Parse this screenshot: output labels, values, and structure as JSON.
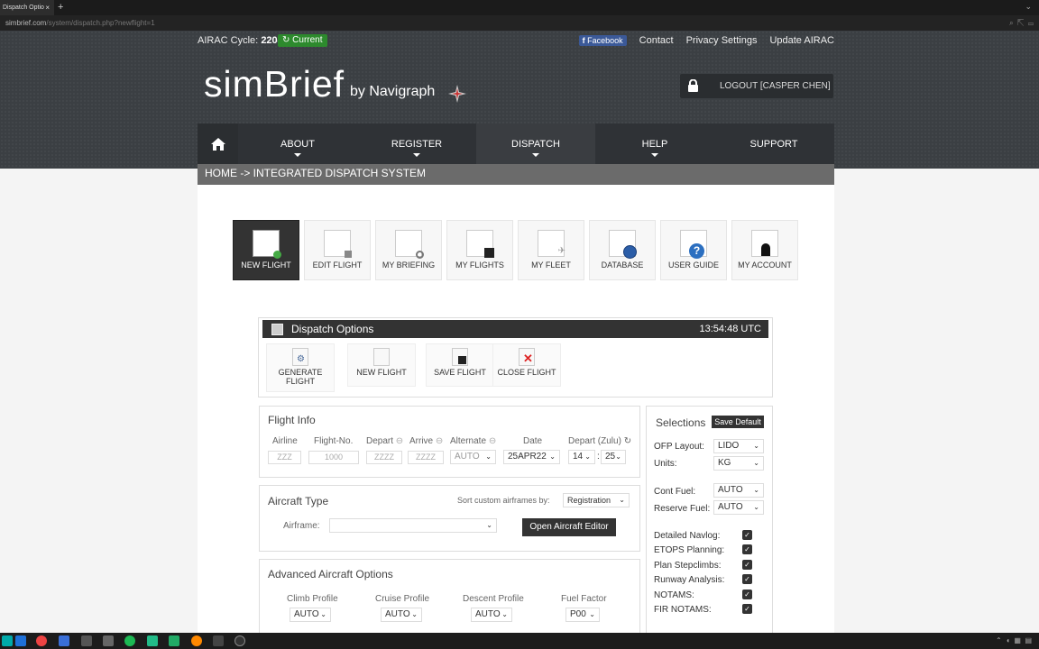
{
  "browser": {
    "tab_title": "Dispatch Optio",
    "tab_close": "×",
    "new_tab": "+",
    "url_host": "simbrief.com",
    "url_path": "/system/dispatch.php?newflight=1"
  },
  "topbar": {
    "airac_label": "AIRAC Cycle:",
    "airac_value": "2204",
    "current_label": "Current",
    "facebook_label": "Facebook",
    "links": [
      "Contact",
      "Privacy Settings",
      "Update AIRAC"
    ]
  },
  "brand": {
    "logo": "simBrief",
    "by": "by Navigraph"
  },
  "account": {
    "logout_label": "LOGOUT [CASPER CHEN]"
  },
  "nav": {
    "items": [
      "ABOUT",
      "REGISTER",
      "DISPATCH",
      "HELP",
      "SUPPORT"
    ],
    "active": "DISPATCH"
  },
  "breadcrumb": "HOME -> INTEGRATED DISPATCH SYSTEM",
  "tools": [
    {
      "label": "NEW FLIGHT",
      "icon": "new-flight-icon"
    },
    {
      "label": "EDIT FLIGHT",
      "icon": "edit-flight-icon"
    },
    {
      "label": "MY BRIEFING",
      "icon": "briefing-icon"
    },
    {
      "label": "MY FLIGHTS",
      "icon": "save-icon"
    },
    {
      "label": "MY FLEET",
      "icon": "fleet-icon"
    },
    {
      "label": "DATABASE",
      "icon": "globe-icon"
    },
    {
      "label": "USER GUIDE",
      "icon": "help-icon"
    },
    {
      "label": "MY ACCOUNT",
      "icon": "user-icon"
    }
  ],
  "dispatch": {
    "title": "Dispatch Options",
    "time": "13:54:48 UTC",
    "buttons": [
      {
        "label_1": "GENERATE",
        "label_2": "FLIGHT",
        "icon": "gear-icon"
      },
      {
        "label": "NEW FLIGHT",
        "icon": "new-doc-icon"
      },
      {
        "label": "SAVE FLIGHT",
        "icon": "save-icon"
      },
      {
        "label": "CLOSE FLIGHT",
        "icon": "close-icon"
      }
    ]
  },
  "flight_info": {
    "title": "Flight Info",
    "airline_label": "Airline",
    "airline_placeholder": "ZZZ",
    "flightno_label": "Flight-No.",
    "flightno_placeholder": "1000",
    "depart_label": "Depart",
    "depart_placeholder": "ZZZZ",
    "arrive_label": "Arrive",
    "arrive_placeholder": "ZZZZ",
    "alternate_label": "Alternate",
    "alternate_value": "AUTO",
    "date_label": "Date",
    "date_value": "25APR22",
    "departzulu_label": "Depart (Zulu)",
    "hour_value": "14",
    "minute_value": "25",
    "time_separator": ":"
  },
  "aircraft": {
    "title": "Aircraft Type",
    "sort_label": "Sort custom airframes by:",
    "sort_value": "Registration",
    "airframe_label": "Airframe:",
    "airframe_value": "",
    "editor_button": "Open Aircraft Editor"
  },
  "advanced": {
    "title": "Advanced Aircraft Options",
    "climb_label": "Climb Profile",
    "climb_value": "AUTO",
    "cruise_label": "Cruise Profile",
    "cruise_value": "AUTO",
    "descent_label": "Descent Profile",
    "descent_value": "AUTO",
    "fuel_label": "Fuel Factor",
    "fuel_value": "P00"
  },
  "selections": {
    "title": "Selections",
    "save_default": "Save Default",
    "ofp_label": "OFP Layout:",
    "ofp_value": "LIDO",
    "units_label": "Units:",
    "units_value": "KG",
    "cont_label": "Cont Fuel:",
    "cont_value": "AUTO",
    "reserve_label": "Reserve Fuel:",
    "reserve_value": "AUTO",
    "checks": [
      "Detailed Navlog:",
      "ETOPS Planning:",
      "Plan Stepclimbs:",
      "Runway Analysis:",
      "NOTAMS:",
      "FIR NOTAMS:"
    ]
  },
  "colors": {
    "accent_green": "#2d8a2d",
    "facebook_blue": "#3b5998",
    "nav_dark": "#2f3236"
  }
}
